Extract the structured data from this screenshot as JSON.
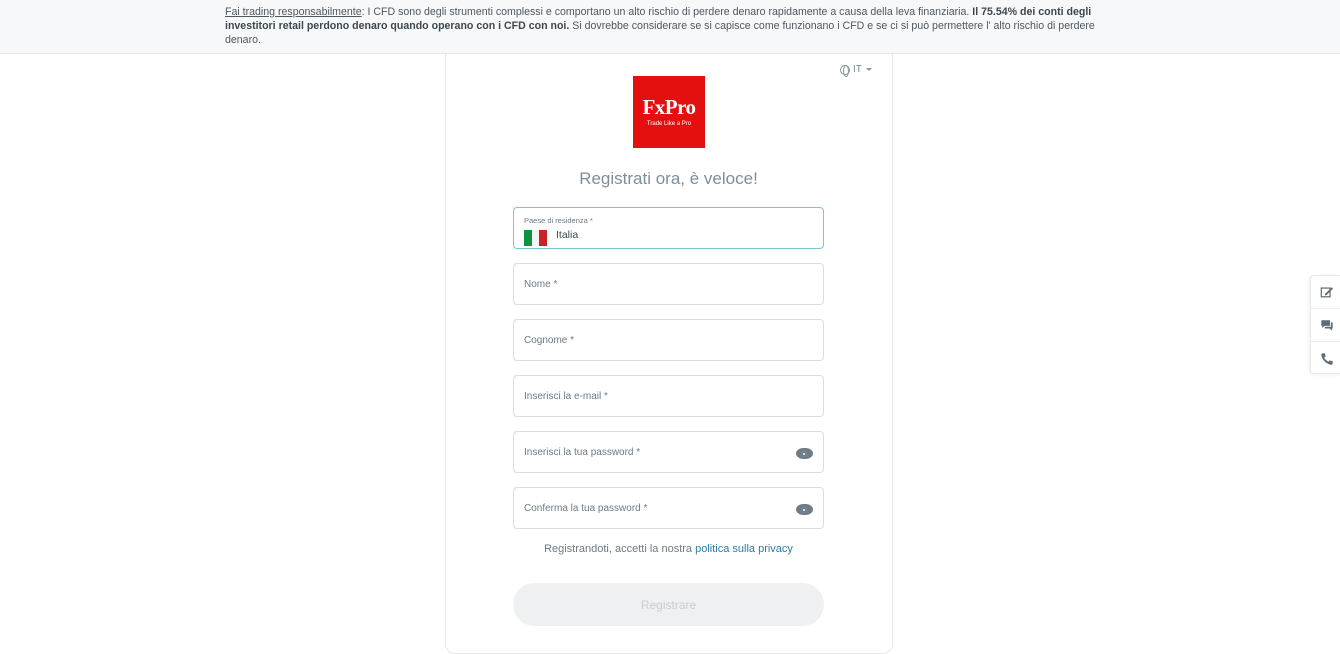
{
  "banner": {
    "lead_link": "Fai trading responsabilmente",
    "text_part1": ": I CFD sono degli strumenti complessi e comportano un alto rischio di perdere denaro rapidamente a causa della leva finanziaria. ",
    "bold_text": "Il 75.54% dei conti degli investitori retail perdono denaro quando operano con i CFD con noi.",
    "text_part2": " Si dovrebbe considerare se si capisce come funzionano i CFD e se ci si può permettere l' alto rischio di perdere denaro."
  },
  "language": {
    "selected": "IT",
    "icon": "globe-icon"
  },
  "logo": {
    "brand": "FxPro",
    "tagline": "Trade Like a Pro",
    "color": "#e3100f"
  },
  "form": {
    "heading": "Registrati ora, è veloce!",
    "country": {
      "label": "Paese di residenza *",
      "value": "Italia",
      "flag": "italy-flag"
    },
    "first_name": {
      "placeholder": "Nome *"
    },
    "last_name": {
      "placeholder": "Cognome *"
    },
    "email": {
      "placeholder": "Inserisci la e-mail *"
    },
    "password": {
      "placeholder": "Inserisci la tua password *"
    },
    "confirm_password": {
      "placeholder": "Conferma la tua password *"
    },
    "consent_text": "Registrandoti, accetti la nostra ",
    "privacy_link": "politica sulla privacy",
    "submit_label": "Registrare"
  },
  "side_tools": [
    "edit-note-icon",
    "chat-icon",
    "phone-icon"
  ]
}
